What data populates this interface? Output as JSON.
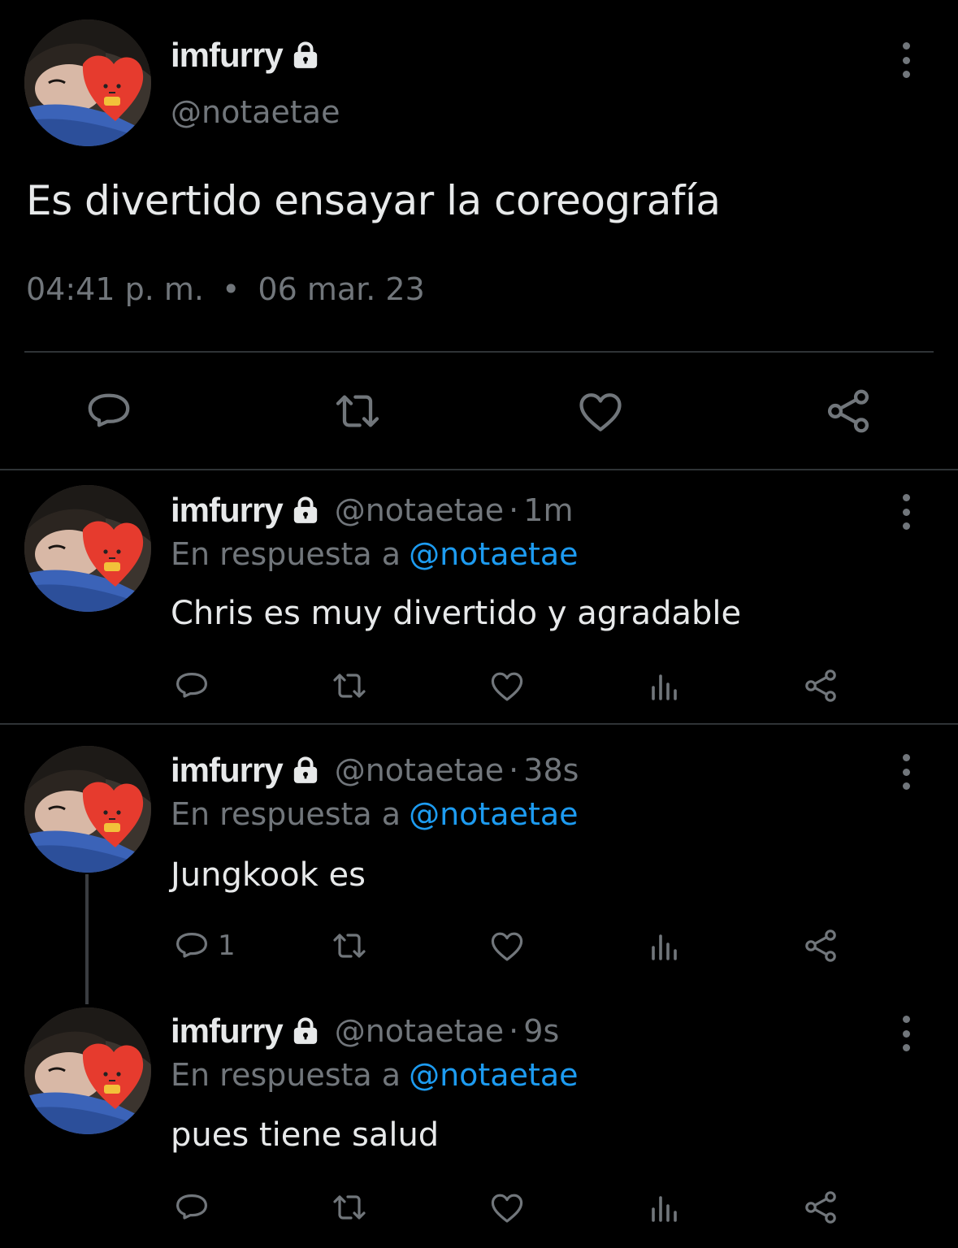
{
  "main_tweet": {
    "name": "imfurry",
    "handle": "@notaetae",
    "text": "Es divertido ensayar la coreografía",
    "time": "04:41 p. m.",
    "separator": "•",
    "date": "06 mar. 23",
    "icons": [
      "reply-icon",
      "retweet-icon",
      "like-icon",
      "share-icon"
    ]
  },
  "replies": [
    {
      "name": "imfurry",
      "handle": "@notaetae",
      "sep": "·",
      "time_ago": "1m",
      "reply_prefix": "En respuesta a",
      "reply_mention": "@notaetae",
      "text": "Chris es muy divertido y agradable",
      "reply_count": ""
    },
    {
      "name": "imfurry",
      "handle": "@notaetae",
      "sep": "·",
      "time_ago": "38s",
      "reply_prefix": "En respuesta a",
      "reply_mention": "@notaetae",
      "text": "Jungkook es",
      "reply_count": "1"
    },
    {
      "name": "imfurry",
      "handle": "@notaetae",
      "sep": "·",
      "time_ago": "9s",
      "reply_prefix": "En respuesta a",
      "reply_mention": "@notaetae",
      "text": "pues tiene salud",
      "reply_count": ""
    }
  ],
  "colors": {
    "background": "#000000",
    "text": "#e7e9ea",
    "secondary": "#71767b",
    "accent": "#1d9bf0",
    "divider": "#2f3336"
  }
}
